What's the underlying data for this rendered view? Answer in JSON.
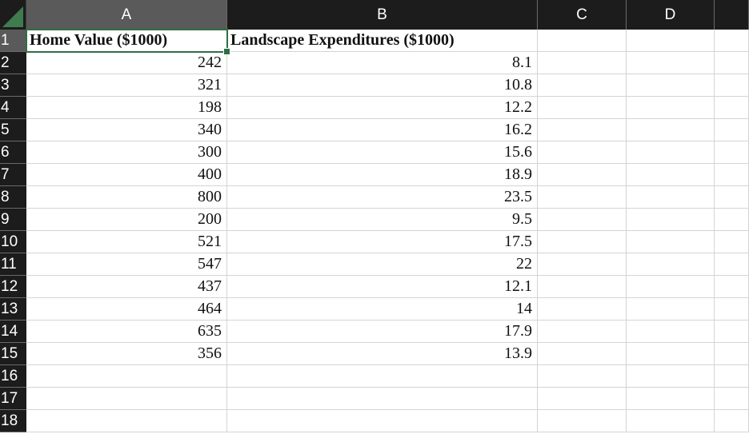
{
  "spreadsheet": {
    "columns": [
      "A",
      "B",
      "C",
      "D"
    ],
    "selected_column": "A",
    "selected_row": "1",
    "row_numbers": [
      "1",
      "2",
      "3",
      "4",
      "5",
      "6",
      "7",
      "8",
      "9",
      "10",
      "11",
      "12",
      "13",
      "14",
      "15",
      "16",
      "17",
      "18"
    ],
    "headers": {
      "A1": "Home Value ($1000)",
      "B1": "Landscape Expenditures ($1000)"
    },
    "rows": [
      {
        "home_value": "242",
        "landscape": "8.1"
      },
      {
        "home_value": "321",
        "landscape": "10.8"
      },
      {
        "home_value": "198",
        "landscape": "12.2"
      },
      {
        "home_value": "340",
        "landscape": "16.2"
      },
      {
        "home_value": "300",
        "landscape": "15.6"
      },
      {
        "home_value": "400",
        "landscape": "18.9"
      },
      {
        "home_value": "800",
        "landscape": "23.5"
      },
      {
        "home_value": "200",
        "landscape": "9.5"
      },
      {
        "home_value": "521",
        "landscape": "17.5"
      },
      {
        "home_value": "547",
        "landscape": "22"
      },
      {
        "home_value": "437",
        "landscape": "12.1"
      },
      {
        "home_value": "464",
        "landscape": "14"
      },
      {
        "home_value": "635",
        "landscape": "17.9"
      },
      {
        "home_value": "356",
        "landscape": "13.9"
      }
    ]
  },
  "colors": {
    "header_bg": "#1c1c1c",
    "header_selected_bg": "#5a5a5a",
    "active_border": "#2e6e44",
    "grid_line": "#d4d4d4"
  }
}
